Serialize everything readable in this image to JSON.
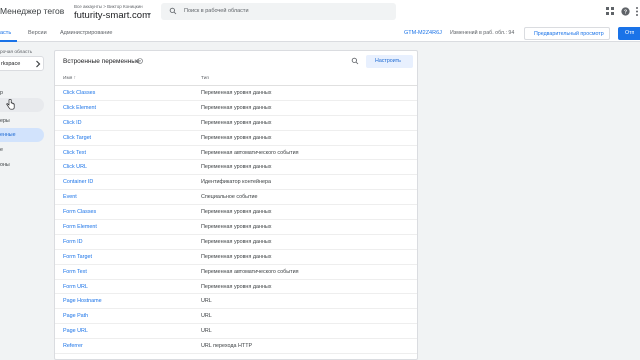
{
  "header": {
    "app_title": "Менеджер тегов",
    "account_breadcrumb": "Все аккаунты > Виктор Коницкин",
    "container_name": "futurity-smart.com",
    "search_placeholder": "Поиск в рабочей области"
  },
  "nav_tabs": [
    {
      "label": "асть",
      "active": true
    },
    {
      "label": "Версии",
      "active": false
    },
    {
      "label": "Администрирование",
      "active": false
    }
  ],
  "toolbar": {
    "container_id": "GTM-M2Z4R6J",
    "changes_text": "Изменений в раб. обл.: 94",
    "preview_label": "Предварительный просмотр",
    "submit_label": "Отп"
  },
  "sidebar": {
    "workspace_label": "рочая область",
    "workspace_value": "rkspace",
    "items": [
      {
        "label": "р",
        "state": "hover"
      },
      {
        "label": "еры",
        "state": "normal"
      },
      {
        "label": "енные",
        "state": "active"
      },
      {
        "label": "е",
        "state": "normal"
      },
      {
        "label": "оны",
        "state": "normal"
      }
    ]
  },
  "card": {
    "title": "Встроенные переменные",
    "configure_label": "Настроить",
    "columns": {
      "name": "Имя ↑",
      "type": "Тип"
    },
    "rows": [
      {
        "name": "Click Classes",
        "type": "Переменная уровня данных"
      },
      {
        "name": "Click Element",
        "type": "Переменная уровня данных"
      },
      {
        "name": "Click ID",
        "type": "Переменная уровня данных"
      },
      {
        "name": "Click Target",
        "type": "Переменная уровня данных"
      },
      {
        "name": "Click Text",
        "type": "Переменная автоматического события"
      },
      {
        "name": "Click URL",
        "type": "Переменная уровня данных"
      },
      {
        "name": "Container ID",
        "type": "Идентификатор контейнера"
      },
      {
        "name": "Event",
        "type": "Специальное событие"
      },
      {
        "name": "Form Classes",
        "type": "Переменная уровня данных"
      },
      {
        "name": "Form Element",
        "type": "Переменная уровня данных"
      },
      {
        "name": "Form ID",
        "type": "Переменная уровня данных"
      },
      {
        "name": "Form Target",
        "type": "Переменная уровня данных"
      },
      {
        "name": "Form Text",
        "type": "Переменная автоматического события"
      },
      {
        "name": "Form URL",
        "type": "Переменная уровня данных"
      },
      {
        "name": "Page Hostname",
        "type": "URL"
      },
      {
        "name": "Page Path",
        "type": "URL"
      },
      {
        "name": "Page URL",
        "type": "URL"
      },
      {
        "name": "Referrer",
        "type": "URL перехода HTTP"
      }
    ]
  },
  "colors": {
    "accent": "#1a73e8",
    "active_nav_bg": "#d2e3fc",
    "page_bg": "#f1f3f4"
  }
}
